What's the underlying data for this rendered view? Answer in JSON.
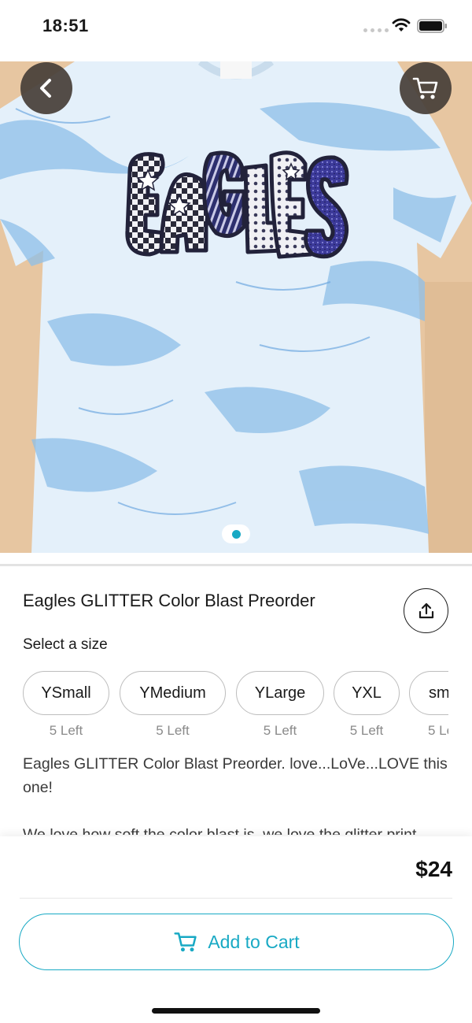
{
  "status_bar": {
    "time": "18:51"
  },
  "product": {
    "title": "Eagles GLITTER Color Blast Preorder",
    "select_size_label": "Select a size",
    "sizes": [
      {
        "label": "YSmall",
        "stock": "5 Left"
      },
      {
        "label": "YMedium",
        "stock": "5 Left"
      },
      {
        "label": "YLarge",
        "stock": "5 Left"
      },
      {
        "label": "YXL",
        "stock": "5 Left"
      },
      {
        "label": "sm",
        "stock": "5 Le"
      }
    ],
    "description_1": "Eagles GLITTER Color Blast Preorder. love...LoVe...LOVE this one!",
    "description_2": "We love how soft the color blast is, we love the glitter print",
    "price": "$24",
    "add_to_cart": "Add to Cart",
    "shirt_print_text": "EAGLES"
  },
  "gallery": {
    "current_page": 1,
    "total_pages": 1
  },
  "icons": {
    "back": "back-chevron-icon",
    "cart": "cart-icon",
    "share": "share-icon",
    "add_cart": "cart-icon"
  },
  "colors": {
    "accent": "#18a9c4",
    "overlay_button": "#463e37",
    "shirt_blue": "#8ebfe8",
    "table": "#e9c9a6"
  }
}
